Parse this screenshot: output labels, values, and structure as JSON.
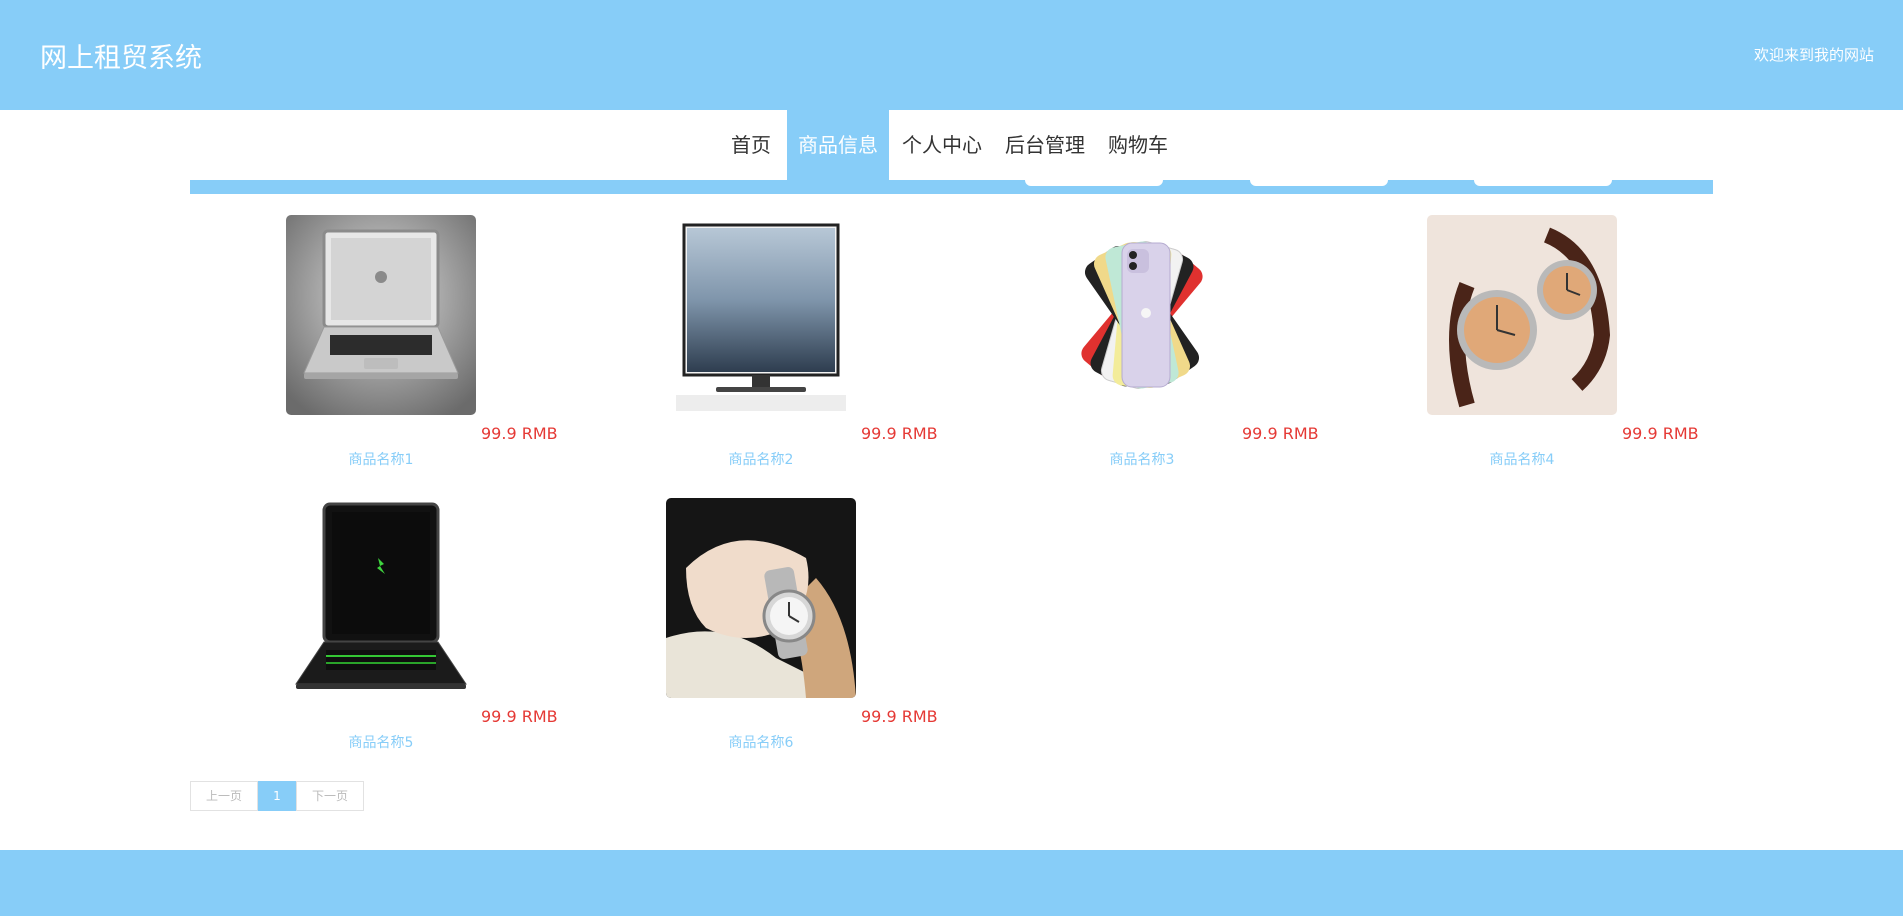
{
  "header": {
    "title": "网上租贸系统",
    "welcome": "欢迎来到我的网站"
  },
  "nav": {
    "home": "首页",
    "products": "商品信息",
    "profile": "个人中心",
    "admin": "后台管理",
    "cart": "购物车",
    "active": "商品信息"
  },
  "products": [
    {
      "name": "商品名称1",
      "price": "99.9 RMB",
      "image": "laptop-silver"
    },
    {
      "name": "商品名称2",
      "price": "99.9 RMB",
      "image": "monitor"
    },
    {
      "name": "商品名称3",
      "price": "99.9 RMB",
      "image": "phone-fan"
    },
    {
      "name": "商品名称4",
      "price": "99.9 RMB",
      "image": "watches-pair"
    },
    {
      "name": "商品名称5",
      "price": "99.9 RMB",
      "image": "laptop-black"
    },
    {
      "name": "商品名称6",
      "price": "99.9 RMB",
      "image": "wrist-watch"
    }
  ],
  "pagination": {
    "prev": "上一页",
    "current": "1",
    "next": "下一页"
  },
  "colors": {
    "accent": "#87cdf8",
    "price": "#e53935"
  }
}
